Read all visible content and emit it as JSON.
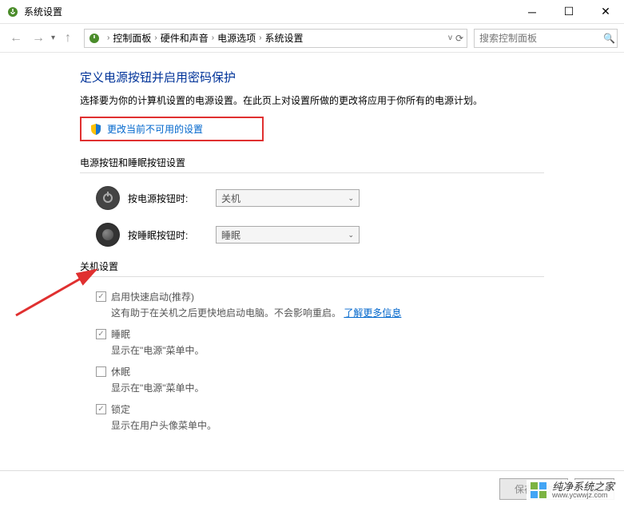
{
  "titlebar": {
    "title": "系统设置"
  },
  "breadcrumb": {
    "items": [
      "控制面板",
      "硬件和声音",
      "电源选项",
      "系统设置"
    ],
    "search_placeholder": "搜索控制面板"
  },
  "page": {
    "title": "定义电源按钮并启用密码保护",
    "description": "选择要为你的计算机设置的电源设置。在此页上对设置所做的更改将应用于你所有的电源计划。",
    "change_unavailable": "更改当前不可用的设置"
  },
  "sections": {
    "buttons_header": "电源按钮和睡眠按钮设置",
    "power_button": {
      "label": "按电源按钮时:",
      "value": "关机"
    },
    "sleep_button": {
      "label": "按睡眠按钮时:",
      "value": "睡眠"
    },
    "shutdown_header": "关机设置",
    "fast_startup": {
      "label": "启用快速启动(推荐)",
      "desc_prefix": "这有助于在关机之后更快地启动电脑。不会影响重启。",
      "learn_more": "了解更多信息"
    },
    "sleep": {
      "label": "睡眠",
      "desc": "显示在\"电源\"菜单中。"
    },
    "hibernate": {
      "label": "休眠",
      "desc": "显示在\"电源\"菜单中。"
    },
    "lock": {
      "label": "锁定",
      "desc": "显示在用户头像菜单中。"
    }
  },
  "footer": {
    "save": "保存修改",
    "cancel": "取"
  },
  "watermark": {
    "name": "纯净系统之家",
    "url": "www.ycwwjz.com"
  }
}
